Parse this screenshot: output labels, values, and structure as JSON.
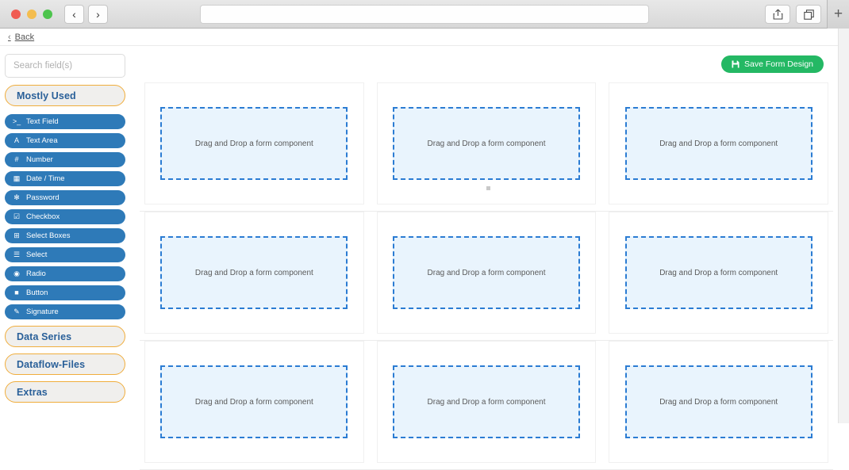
{
  "browser": {
    "back_icon": "chevron-left-icon",
    "forward_icon": "chevron-right-icon",
    "back_glyph": "‹",
    "forward_glyph": "›",
    "address_value": "",
    "address_placeholder": "",
    "share_icon": "share-icon",
    "tabs_icon": "tabs-icon",
    "new_tab_glyph": "+"
  },
  "page": {
    "back_label": "Back",
    "back_chevron": "‹"
  },
  "sidebar": {
    "search": {
      "value": "",
      "placeholder": "Search field(s)"
    },
    "sections": [
      {
        "label": "Mostly Used",
        "expanded": true
      },
      {
        "label": "Data Series",
        "expanded": false
      },
      {
        "label": "Dataflow-Files",
        "expanded": false
      },
      {
        "label": "Extras",
        "expanded": false
      }
    ],
    "fields": [
      {
        "label": "Text Field",
        "icon": "terminal-prompt-icon",
        "glyph": ">_"
      },
      {
        "label": "Text Area",
        "icon": "letter-a-icon",
        "glyph": "A"
      },
      {
        "label": "Number",
        "icon": "hash-icon",
        "glyph": "#"
      },
      {
        "label": "Date / Time",
        "icon": "calendar-icon",
        "glyph": "▦"
      },
      {
        "label": "Password",
        "icon": "asterisk-icon",
        "glyph": "✻"
      },
      {
        "label": "Checkbox",
        "icon": "checkbox-icon",
        "glyph": "☑"
      },
      {
        "label": "Select Boxes",
        "icon": "plus-square-icon",
        "glyph": "⊞"
      },
      {
        "label": "Select",
        "icon": "list-icon",
        "glyph": "☰"
      },
      {
        "label": "Radio",
        "icon": "radio-icon",
        "glyph": "◉"
      },
      {
        "label": "Button",
        "icon": "square-icon",
        "glyph": "■"
      },
      {
        "label": "Signature",
        "icon": "pencil-icon",
        "glyph": "✎"
      }
    ]
  },
  "toolbar": {
    "save_label": "Save Form Design",
    "save_icon": "save-disk-icon"
  },
  "canvas": {
    "dropzone_text": "Drag and Drop a form component",
    "rows": [
      {
        "cells": [
          {
            "marker": false
          },
          {
            "marker": true
          },
          {
            "marker": false
          }
        ]
      },
      {
        "cells": [
          {
            "marker": false
          },
          {
            "marker": false
          },
          {
            "marker": false
          }
        ]
      },
      {
        "cells": [
          {
            "marker": false
          },
          {
            "marker": false
          },
          {
            "marker": false
          }
        ]
      }
    ]
  },
  "colors": {
    "accent_blue": "#2e7ab8",
    "dropzone_border": "#2b7cd3",
    "dropzone_fill": "#e9f4fd",
    "section_border": "#f0ad3c",
    "save_green": "#24b864"
  }
}
